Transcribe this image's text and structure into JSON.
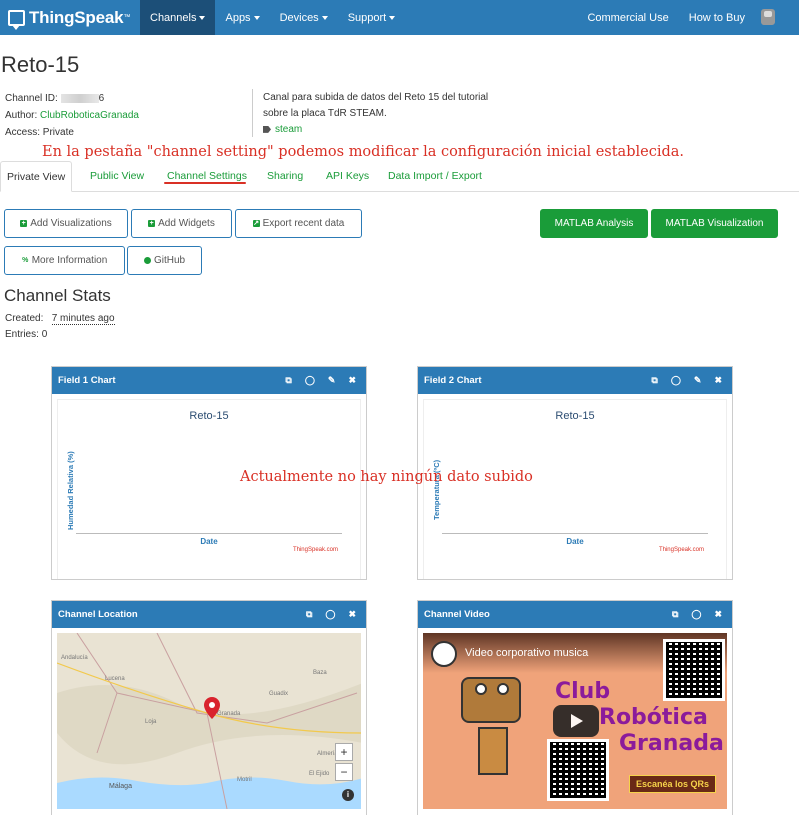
{
  "nav": {
    "brand": "ThingSpeak",
    "brand_tm": "™",
    "items": [
      "Channels",
      "Apps",
      "Devices",
      "Support"
    ],
    "right": [
      "Commercial Use",
      "How to Buy"
    ]
  },
  "channel": {
    "title": "Reto-15",
    "id_label": "Channel ID:",
    "id_value_suffix": "6",
    "author_label": "Author:",
    "author_value": "ClubRoboticaGranada",
    "access_label": "Access:",
    "access_value": "Private",
    "description": "Canal para subida de datos del Reto 15 del tutorial sobre la placa TdR STEAM.",
    "tag": "steam"
  },
  "annotations": {
    "tabs_note": "En la pestaña \"channel setting\" podemos modificar la configuración inicial establecida.",
    "no_data_note": "Actualmente no hay ningún dato subido"
  },
  "tabs": [
    "Private View",
    "Public View",
    "Channel Settings",
    "Sharing",
    "API Keys",
    "Data Import / Export"
  ],
  "buttons": {
    "add_visualizations": "Add Visualizations",
    "add_widgets": "Add Widgets",
    "export_recent": "Export recent data",
    "more_info": "More Information",
    "github": "GitHub",
    "matlab_analysis": "MATLAB Analysis",
    "matlab_visualization": "MATLAB Visualization"
  },
  "stats": {
    "title": "Channel Stats",
    "created_label": "Created:",
    "created_value": "7 minutes ago",
    "entries_label": "Entries:",
    "entries_value": "0"
  },
  "widgets": {
    "field1": {
      "header": "Field 1 Chart",
      "title": "Reto-15",
      "ylabel": "Humedad Relativa (%)",
      "xlabel": "Date",
      "credit": "ThingSpeak.com"
    },
    "field2": {
      "header": "Field 2 Chart",
      "title": "Reto-15",
      "ylabel": "Temperatura (ºC)",
      "xlabel": "Date",
      "credit": "ThingSpeak.com"
    },
    "location": {
      "header": "Channel Location",
      "labels": [
        "Andalucía",
        "Lucena",
        "Loja",
        "Granada",
        "Guadix",
        "Baza",
        "Málaga",
        "Motril",
        "Almería",
        "El Ejido"
      ]
    },
    "video": {
      "header": "Channel Video",
      "title": "Video corporativo musica",
      "overlay_lines": [
        "Club",
        "Robótica",
        "Granada"
      ],
      "scan_text": "Escanéa los QRs"
    }
  },
  "colors": {
    "navbar": "#2c7bb6",
    "green": "#1a9c39",
    "annotation": "#d93025"
  }
}
